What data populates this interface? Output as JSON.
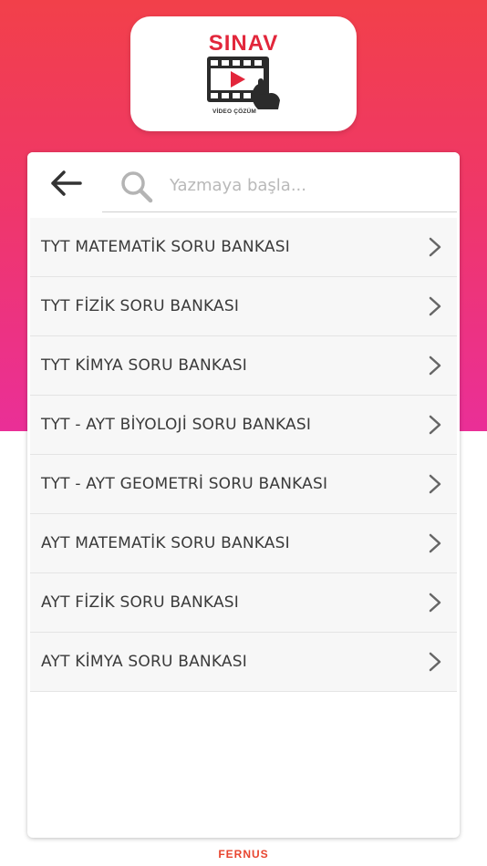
{
  "logo": {
    "title": "SINAV",
    "subtitle": "VİDEO ÇÖZÜM",
    "icon": "video-play-hand-icon"
  },
  "search": {
    "placeholder": "Yazmaya başla...",
    "value": ""
  },
  "colors": {
    "gradient_top": "#f2404a",
    "gradient_bottom": "#ea2f97",
    "brand_red": "#e2263b",
    "footer": "#e8452f"
  },
  "books": [
    {
      "label": "TYT MATEMATİK SORU BANKASI"
    },
    {
      "label": "TYT FİZİK SORU BANKASI"
    },
    {
      "label": "TYT KİMYA SORU BANKASI"
    },
    {
      "label": "TYT - AYT BİYOLOJİ SORU BANKASI"
    },
    {
      "label": "TYT - AYT GEOMETRİ SORU BANKASI"
    },
    {
      "label": "AYT MATEMATİK SORU BANKASI"
    },
    {
      "label": "AYT FİZİK SORU BANKASI"
    },
    {
      "label": "AYT KİMYA SORU BANKASI"
    }
  ],
  "footer": {
    "brand": "FERNUS"
  }
}
